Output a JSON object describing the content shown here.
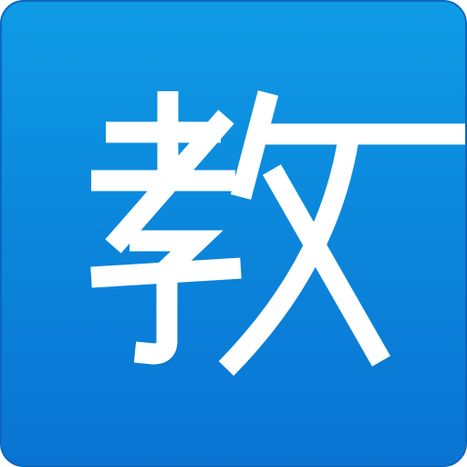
{
  "icon": {
    "character": "教",
    "background_color_top": "#0f9be6",
    "background_color_bottom": "#0a74d3",
    "glyph_color": "#ffffff",
    "glyph_icon_name": "jiao-character-icon"
  }
}
